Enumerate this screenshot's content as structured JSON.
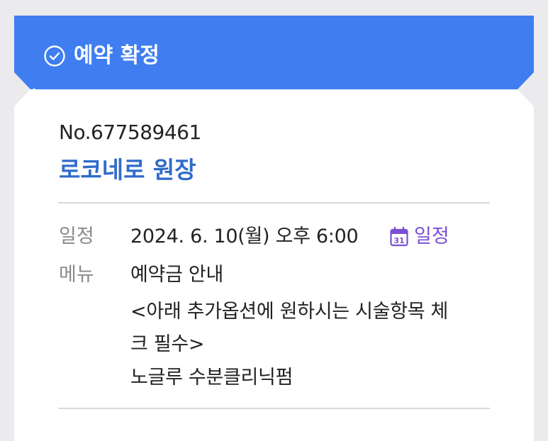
{
  "header": {
    "title": "예약 확정",
    "icon": "check-circle-icon",
    "color": "#3f7df0"
  },
  "booking": {
    "number": "No.677589461",
    "shop_name": "로코네로 원장"
  },
  "schedule": {
    "label": "일정",
    "value": "2024. 6. 10(월) 오후 6:00",
    "calendar_day": "31",
    "calendar_link_label": "일정",
    "calendar_icon": "calendar-icon",
    "link_color": "#7b4fd6"
  },
  "menu": {
    "label": "메뉴",
    "lines": [
      "예약금 안내",
      "<아래 추가옵션에 원하시는 시술항목 체",
      "크 필수>",
      "노글루 수분클리닉펌"
    ]
  }
}
